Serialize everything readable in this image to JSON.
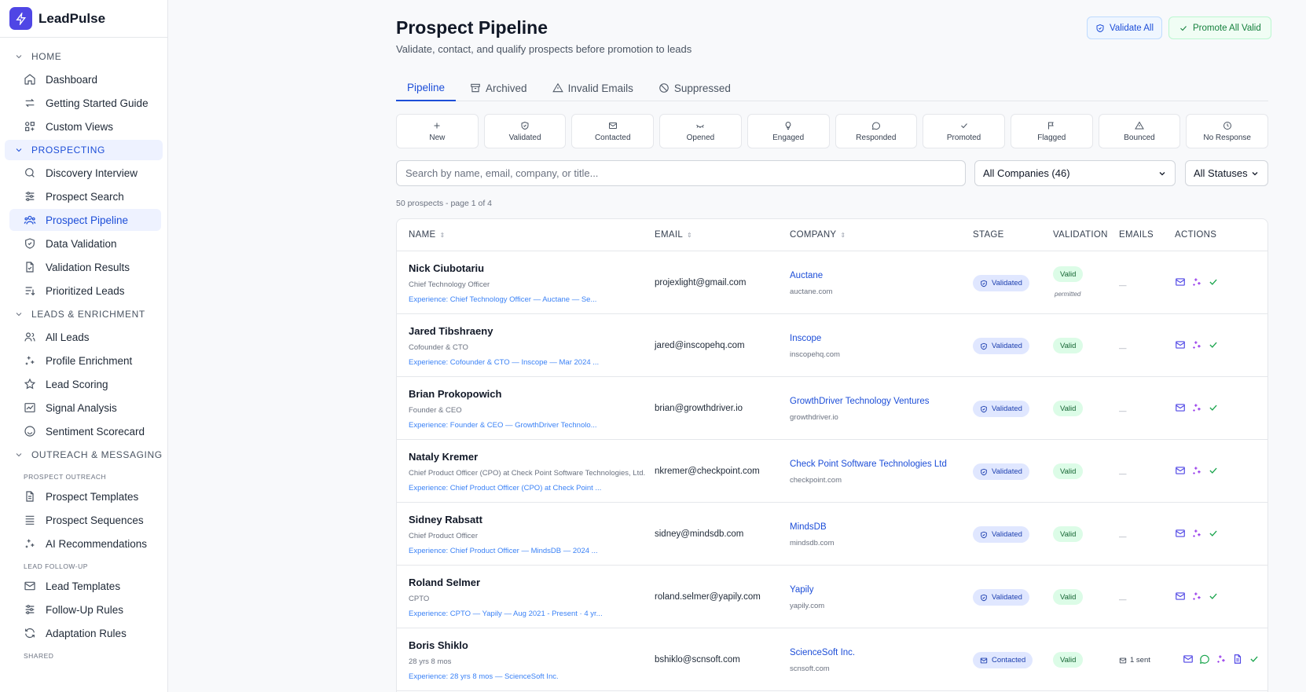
{
  "brand": {
    "name": "LeadPulse"
  },
  "sidebar": {
    "sections": [
      {
        "label": "HOME",
        "active": false,
        "items": [
          {
            "label": "Dashboard",
            "icon": "home-icon"
          },
          {
            "label": "Getting Started Guide",
            "icon": "arrows-icon"
          },
          {
            "label": "Custom Views",
            "icon": "views-icon"
          }
        ]
      },
      {
        "label": "PROSPECTING",
        "active": true,
        "items": [
          {
            "label": "Discovery Interview",
            "icon": "search-icon"
          },
          {
            "label": "Prospect Search",
            "icon": "sliders-icon"
          },
          {
            "label": "Prospect Pipeline",
            "icon": "users-icon",
            "active": true
          },
          {
            "label": "Data Validation",
            "icon": "shield-icon"
          },
          {
            "label": "Validation Results",
            "icon": "file-check-icon"
          },
          {
            "label": "Prioritized Leads",
            "icon": "list-sort-icon"
          }
        ]
      },
      {
        "label": "LEADS & ENRICHMENT",
        "active": false,
        "items": [
          {
            "label": "All Leads",
            "icon": "users-icon"
          },
          {
            "label": "Profile Enrichment",
            "icon": "sparkles-icon"
          },
          {
            "label": "Lead Scoring",
            "icon": "star-icon"
          },
          {
            "label": "Signal Analysis",
            "icon": "chart-icon"
          },
          {
            "label": "Sentiment Scorecard",
            "icon": "smile-icon"
          }
        ]
      },
      {
        "label": "OUTREACH & MESSAGING",
        "active": false,
        "groups": [
          {
            "label": "PROSPECT OUTREACH",
            "items": [
              {
                "label": "Prospect Templates",
                "icon": "file-icon"
              },
              {
                "label": "Prospect Sequences",
                "icon": "list-icon"
              },
              {
                "label": "AI Recommendations",
                "icon": "sparkles-icon"
              }
            ]
          },
          {
            "label": "LEAD FOLLOW-UP",
            "items": [
              {
                "label": "Lead Templates",
                "icon": "mail-icon"
              },
              {
                "label": "Follow-Up Rules",
                "icon": "sliders-icon"
              },
              {
                "label": "Adaptation Rules",
                "icon": "refresh-icon"
              }
            ]
          },
          {
            "label": "SHARED",
            "items": []
          }
        ]
      }
    ]
  },
  "header": {
    "title": "Prospect Pipeline",
    "subtitle": "Validate, contact, and qualify prospects before promotion to leads",
    "validate_all": "Validate All",
    "promote_all": "Promote All Valid"
  },
  "tabs": [
    {
      "label": "Pipeline",
      "active": true,
      "icon": ""
    },
    {
      "label": "Archived",
      "active": false,
      "icon": "archive-icon"
    },
    {
      "label": "Invalid Emails",
      "active": false,
      "icon": "alert-triangle-icon"
    },
    {
      "label": "Suppressed",
      "active": false,
      "icon": "ban-icon"
    }
  ],
  "stages": [
    {
      "label": "New",
      "icon": "plus-icon"
    },
    {
      "label": "Validated",
      "icon": "shield-check-icon"
    },
    {
      "label": "Contacted",
      "icon": "mail-icon"
    },
    {
      "label": "Opened",
      "icon": "eye-icon"
    },
    {
      "label": "Engaged",
      "icon": "lightbulb-icon"
    },
    {
      "label": "Responded",
      "icon": "message-icon"
    },
    {
      "label": "Promoted",
      "icon": "check-icon"
    },
    {
      "label": "Flagged",
      "icon": "flag-icon"
    },
    {
      "label": "Bounced",
      "icon": "alert-triangle-icon"
    },
    {
      "label": "No Response",
      "icon": "clock-icon"
    }
  ],
  "filters": {
    "search_placeholder": "Search by name, email, company, or title...",
    "company_select": "All Companies (46)",
    "status_select": "All Statuses"
  },
  "count_text": "50 prospects - page 1 of 4",
  "table": {
    "columns": [
      "NAME",
      "EMAIL",
      "COMPANY",
      "STAGE",
      "VALIDATION",
      "EMAILS",
      "ACTIONS"
    ],
    "rows": [
      {
        "name": "Nick Ciubotariu",
        "title": "Chief Technology Officer",
        "experience": "Experience: Chief Technology Officer — Auctane — Se...",
        "email": "projexlight@gmail.com",
        "company": "Auctane",
        "domain": "auctane.com",
        "stage": "Validated",
        "validation": "Valid",
        "validation_note": "permitted",
        "emails": "—"
      },
      {
        "name": "Jared Tibshraeny",
        "title": "Cofounder & CTO",
        "experience": "Experience: Cofounder & CTO — Inscope — Mar 2024 ...",
        "email": "jared@inscopehq.com",
        "company": "Inscope",
        "domain": "inscopehq.com",
        "stage": "Validated",
        "validation": "Valid",
        "validation_note": "",
        "emails": "—"
      },
      {
        "name": "Brian Prokopowich",
        "title": "Founder & CEO",
        "experience": "Experience: Founder & CEO — GrowthDriver Technolo...",
        "email": "brian@growthdriver.io",
        "company": "GrowthDriver Technology Ventures",
        "domain": "growthdriver.io",
        "stage": "Validated",
        "validation": "Valid",
        "validation_note": "",
        "emails": "—"
      },
      {
        "name": "Nataly Kremer",
        "title": "Chief Product Officer (CPO) at Check Point Software Technologies, Ltd.",
        "experience": "Experience: Chief Product Officer (CPO) at Check Point ...",
        "email": "nkremer@checkpoint.com",
        "company": "Check Point Software Technologies Ltd",
        "domain": "checkpoint.com",
        "stage": "Validated",
        "validation": "Valid",
        "validation_note": "",
        "emails": "—"
      },
      {
        "name": "Sidney Rabsatt",
        "title": "Chief Product Officer",
        "experience": "Experience: Chief Product Officer — MindsDB — 2024 ...",
        "email": "sidney@mindsdb.com",
        "company": "MindsDB",
        "domain": "mindsdb.com",
        "stage": "Validated",
        "validation": "Valid",
        "validation_note": "",
        "emails": "—"
      },
      {
        "name": "Roland Selmer",
        "title": "CPTO",
        "experience": "Experience: CPTO — Yapily — Aug 2021 - Present · 4 yr...",
        "email": "roland.selmer@yapily.com",
        "company": "Yapily",
        "domain": "yapily.com",
        "stage": "Validated",
        "validation": "Valid",
        "validation_note": "",
        "emails": "—"
      },
      {
        "name": "Boris Shiklo",
        "title": "28 yrs 8 mos",
        "experience": "Experience: 28 yrs 8 mos — ScienceSoft Inc.",
        "email": "bshiklo@scnsoft.com",
        "company": "ScienceSoft Inc.",
        "domain": "scnsoft.com",
        "stage": "Contacted",
        "validation": "Valid",
        "validation_note": "",
        "emails": "1 sent"
      }
    ]
  },
  "colors": {
    "accent": "#1d4ed8",
    "brand": "#4f46e5",
    "valid_bg": "#dcfce7",
    "valid_text": "#166534",
    "action_mail": "#4f46e5",
    "action_sparkle": "#9333ea",
    "action_check": "#16a34a"
  }
}
